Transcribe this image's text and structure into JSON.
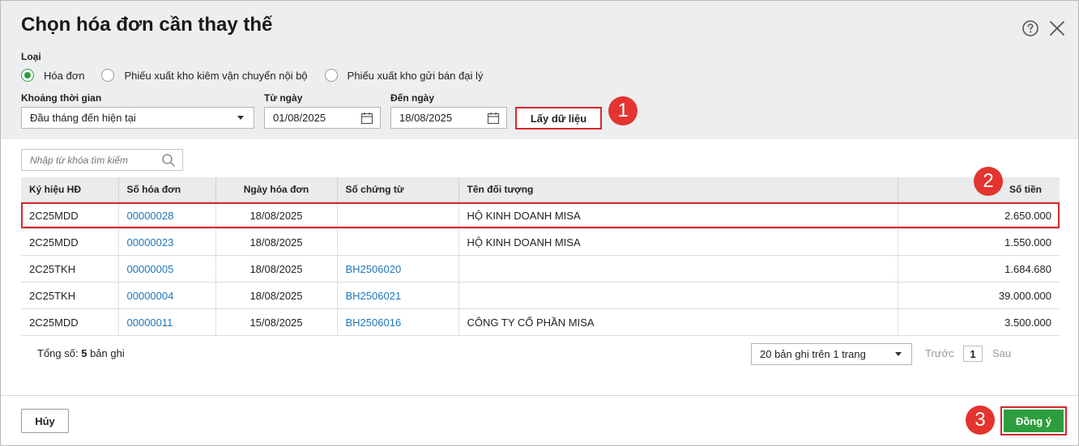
{
  "dialog": {
    "title": "Chọn hóa đơn cần thay thế"
  },
  "type_section": {
    "label": "Loại",
    "options": [
      {
        "label": "Hóa đơn",
        "checked": true
      },
      {
        "label": "Phiếu xuất kho kiêm vận chuyển nội bộ",
        "checked": false
      },
      {
        "label": "Phiếu xuất kho gửi bán đại lý",
        "checked": false
      }
    ]
  },
  "filters": {
    "period_label": "Khoảng thời gian",
    "period_value": "Đầu tháng đến hiện tại",
    "from_label": "Từ ngày",
    "from_value": "01/08/2025",
    "to_label": "Đến ngày",
    "to_value": "18/08/2025",
    "fetch_button": "Lấy dữ liệu"
  },
  "search": {
    "placeholder": "Nhập từ khóa tìm kiếm"
  },
  "table": {
    "columns": [
      "Ký hiệu HĐ",
      "Số hóa đơn",
      "Ngày hóa đơn",
      "Số chứng từ",
      "Tên đối tượng",
      "Số tiền"
    ],
    "rows": [
      [
        "2C25MDD",
        "00000028",
        "18/08/2025",
        "",
        "HỘ KINH DOANH MISA",
        "2.650.000"
      ],
      [
        "2C25MDD",
        "00000023",
        "18/08/2025",
        "",
        "HỘ KINH DOANH MISA",
        "1.550.000"
      ],
      [
        "2C25TKH",
        "00000005",
        "18/08/2025",
        "BH2506020",
        "",
        "1.684.680"
      ],
      [
        "2C25TKH",
        "00000004",
        "18/08/2025",
        "BH2506021",
        "",
        "39.000.000"
      ],
      [
        "2C25MDD",
        "00000011",
        "15/08/2025",
        "BH2506016",
        "CÔNG TY CỔ PHẦN MISA",
        "3.500.000"
      ]
    ]
  },
  "summary": {
    "total_prefix": "Tổng số:",
    "total_count": "5",
    "total_suffix": "bản ghi"
  },
  "pager": {
    "page_size": "20 bản ghi trên 1 trang",
    "prev": "Trước",
    "current": "1",
    "next": "Sau"
  },
  "footer": {
    "cancel": "Hủy",
    "ok": "Đồng ý"
  },
  "steps": [
    "1",
    "2",
    "3"
  ],
  "colors": {
    "accent_green": "#2e9d3e",
    "highlight_red": "#d9262c",
    "badge_red": "#e3342f",
    "link_blue": "#1f75b8"
  }
}
